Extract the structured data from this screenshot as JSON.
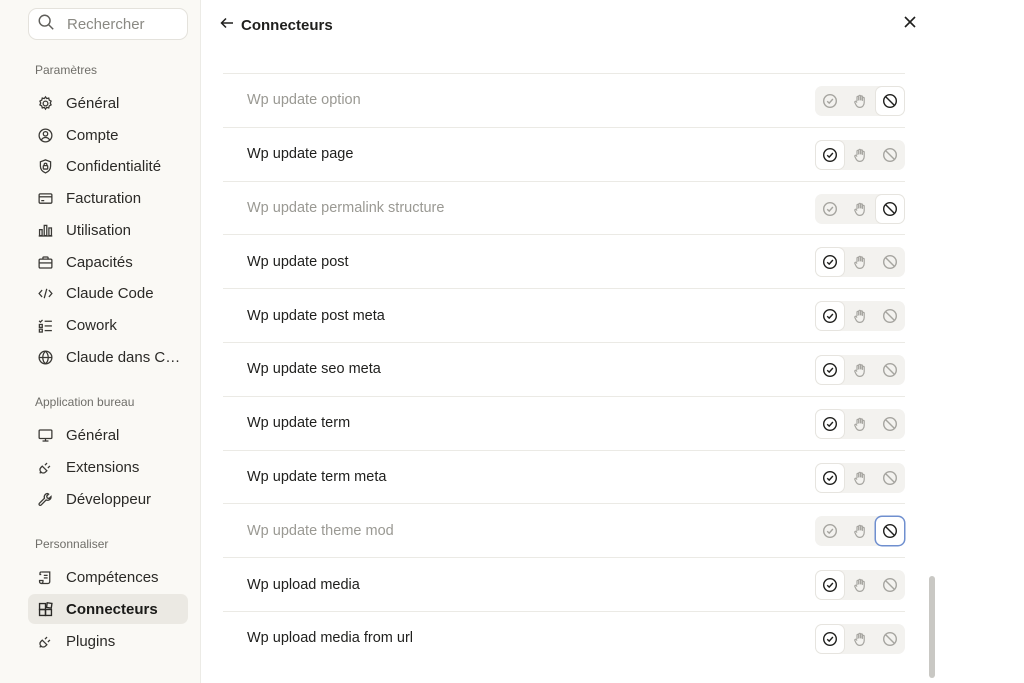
{
  "search": {
    "placeholder": "Rechercher"
  },
  "sidebar": {
    "sections": [
      {
        "label": "Paramètres"
      },
      {
        "label": "Application bureau"
      },
      {
        "label": "Personnaliser"
      }
    ],
    "items": [
      {
        "label": "Général",
        "icon": "gear-icon"
      },
      {
        "label": "Compte",
        "icon": "user-circle-icon"
      },
      {
        "label": "Confidentialité",
        "icon": "shield-lock-icon"
      },
      {
        "label": "Facturation",
        "icon": "credit-card-icon"
      },
      {
        "label": "Utilisation",
        "icon": "bar-chart-icon"
      },
      {
        "label": "Capacités",
        "icon": "briefcase-icon"
      },
      {
        "label": "Claude Code",
        "icon": "code-icon"
      },
      {
        "label": "Cowork",
        "icon": "checklist-icon"
      },
      {
        "label": "Claude dans Chrome",
        "icon": "globe-icon"
      },
      {
        "label": "Général",
        "icon": "monitor-icon"
      },
      {
        "label": "Extensions",
        "icon": "plug-icon"
      },
      {
        "label": "Développeur",
        "icon": "wrench-icon"
      },
      {
        "label": "Compétences",
        "icon": "scroll-icon"
      },
      {
        "label": "Connecteurs",
        "icon": "blocks-icon",
        "active": true
      },
      {
        "label": "Plugins",
        "icon": "plug-icon"
      }
    ]
  },
  "header": {
    "title": "Connecteurs",
    "back_icon": "arrow-left-icon",
    "close_icon": "close-icon"
  },
  "tools": [
    {
      "name": "Wp update option",
      "state": "blocked",
      "disabled": true
    },
    {
      "name": "Wp update page",
      "state": "allow",
      "disabled": false
    },
    {
      "name": "Wp update permalink structure",
      "state": "blocked",
      "disabled": true
    },
    {
      "name": "Wp update post",
      "state": "allow",
      "disabled": false
    },
    {
      "name": "Wp update post meta",
      "state": "allow",
      "disabled": false
    },
    {
      "name": "Wp update seo meta",
      "state": "allow",
      "disabled": false
    },
    {
      "name": "Wp update term",
      "state": "allow",
      "disabled": false
    },
    {
      "name": "Wp update term meta",
      "state": "allow",
      "disabled": false
    },
    {
      "name": "Wp update theme mod",
      "state": "blocked",
      "disabled": true,
      "focused": true
    },
    {
      "name": "Wp upload media",
      "state": "allow",
      "disabled": false
    },
    {
      "name": "Wp upload media from url",
      "state": "allow",
      "disabled": false
    }
  ],
  "colors": {
    "sidebar_bg": "#faf9f5",
    "active_item_bg": "#ebe9e3",
    "focus_ring": "#6f8fcf",
    "disabled_text": "#9a9993"
  }
}
